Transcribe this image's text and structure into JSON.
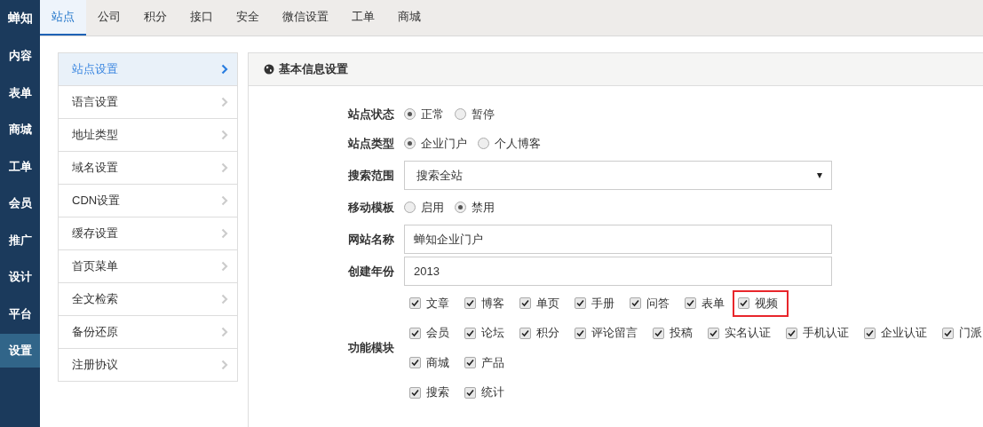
{
  "brand": "蝉知",
  "left_nav": [
    {
      "label": "内容",
      "kind": "item",
      "selected": false
    },
    {
      "label": "表单",
      "kind": "item",
      "selected": false
    },
    {
      "label": "商城",
      "kind": "item",
      "selected": false
    },
    {
      "label": "工单",
      "kind": "item",
      "selected": false
    },
    {
      "label": "会员",
      "kind": "item",
      "selected": false
    },
    {
      "label": "推广",
      "kind": "item",
      "selected": false
    },
    {
      "label": "设计",
      "kind": "item",
      "selected": false
    },
    {
      "label": "平台",
      "kind": "item",
      "selected": false
    },
    {
      "label": "设置",
      "kind": "item",
      "selected": true
    }
  ],
  "tabs": [
    {
      "label": "站点",
      "selected": true
    },
    {
      "label": "公司",
      "selected": false
    },
    {
      "label": "积分",
      "selected": false
    },
    {
      "label": "接口",
      "selected": false
    },
    {
      "label": "安全",
      "selected": false
    },
    {
      "label": "微信设置",
      "selected": false
    },
    {
      "label": "工单",
      "selected": false
    },
    {
      "label": "商城",
      "selected": false
    }
  ],
  "side_menu": [
    {
      "label": "站点设置",
      "selected": true
    },
    {
      "label": "语言设置",
      "selected": false
    },
    {
      "label": "地址类型",
      "selected": false
    },
    {
      "label": "域名设置",
      "selected": false
    },
    {
      "label": "CDN设置",
      "selected": false
    },
    {
      "label": "缓存设置",
      "selected": false
    },
    {
      "label": "首页菜单",
      "selected": false
    },
    {
      "label": "全文检索",
      "selected": false
    },
    {
      "label": "备份还原",
      "selected": false
    },
    {
      "label": "注册协议",
      "selected": false
    }
  ],
  "panel": {
    "title": "基本信息设置",
    "fields": [
      {
        "label": "站点状态",
        "kind": "radio",
        "options": [
          {
            "label": "正常",
            "selected": true
          },
          {
            "label": "暂停",
            "selected": false
          }
        ]
      },
      {
        "label": "站点类型",
        "kind": "radio",
        "options": [
          {
            "label": "企业门户",
            "selected": true
          },
          {
            "label": "个人博客",
            "selected": false
          }
        ]
      },
      {
        "label": "搜索范围",
        "kind": "select",
        "value": "搜索全站"
      },
      {
        "label": "移动模板",
        "kind": "radio",
        "options": [
          {
            "label": "启用",
            "selected": false
          },
          {
            "label": "禁用",
            "selected": true
          }
        ]
      },
      {
        "label": "网站名称",
        "kind": "text",
        "value": "蝉知企业门户"
      },
      {
        "label": "创建年份",
        "kind": "text",
        "value": "2013"
      }
    ],
    "modules": {
      "label": "功能模块",
      "rows": [
        {
          "items": [
            {
              "label": "文章",
              "checked": true,
              "highlighted": false
            },
            {
              "label": "博客",
              "checked": true,
              "highlighted": false
            },
            {
              "label": "单页",
              "checked": true,
              "highlighted": false
            },
            {
              "label": "手册",
              "checked": true,
              "highlighted": false
            },
            {
              "label": "问答",
              "checked": true,
              "highlighted": false
            },
            {
              "label": "表单",
              "checked": true,
              "highlighted": false
            },
            {
              "label": "视频",
              "checked": true,
              "highlighted": true
            }
          ]
        },
        {
          "items": [
            {
              "label": "会员",
              "checked": true,
              "highlighted": false
            },
            {
              "label": "论坛",
              "checked": true,
              "highlighted": false
            },
            {
              "label": "积分",
              "checked": true,
              "highlighted": false
            },
            {
              "label": "评论留言",
              "checked": true,
              "highlighted": false
            },
            {
              "label": "投稿",
              "checked": true,
              "highlighted": false
            },
            {
              "label": "实名认证",
              "checked": true,
              "highlighted": false
            },
            {
              "label": "手机认证",
              "checked": true,
              "highlighted": false
            },
            {
              "label": "企业认证",
              "checked": true,
              "highlighted": false
            },
            {
              "label": "门派",
              "checked": true,
              "highlighted": false
            }
          ]
        },
        {
          "items": [
            {
              "label": "商城",
              "checked": true,
              "highlighted": false
            },
            {
              "label": "产品",
              "checked": true,
              "highlighted": false
            }
          ]
        },
        {
          "items": [
            {
              "label": "搜索",
              "checked": true,
              "highlighted": false
            },
            {
              "label": "统计",
              "checked": true,
              "highlighted": false
            }
          ]
        }
      ]
    }
  }
}
